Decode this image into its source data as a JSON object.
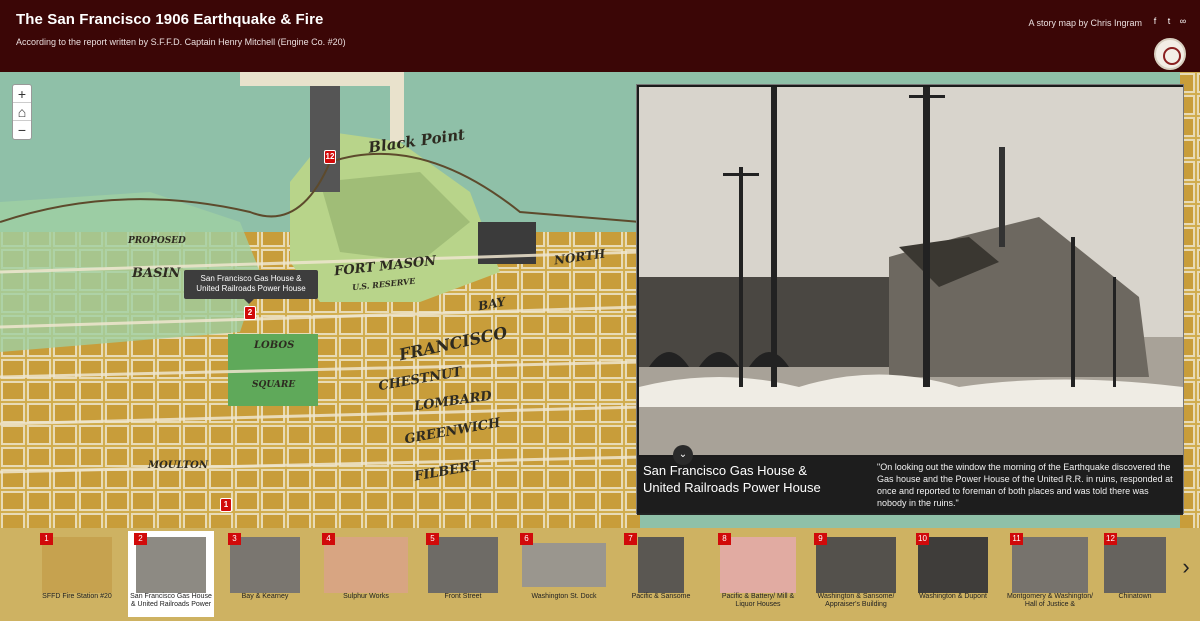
{
  "header": {
    "title": "The San Francisco 1906 Earthquake & Fire",
    "subtitle": "According to the report written by S.F.F.D. Captain Henry Mitchell (Engine Co. #20)",
    "author": "A story map by Chris Ingram",
    "share_icons": [
      "facebook-icon",
      "twitter-icon",
      "link-icon"
    ]
  },
  "map": {
    "zoom_in": "+",
    "home": "⌂",
    "zoom_out": "−",
    "labels": {
      "black_point": "Black Point",
      "fort_mason": "FORT MASON",
      "reserve": "U.S. RESERVE",
      "basin": "BASIN",
      "proposed": "PROPOSED",
      "lobos": "LOBOS",
      "square": "SQUARE",
      "francisco": "FRANCISCO",
      "chestnut": "CHESTNUT",
      "lombard": "LOMBARD",
      "greenwich": "GREENWICH",
      "filbert": "FILBERT",
      "north": "NORTH",
      "bay": "BAY",
      "moulton": "MOULTON"
    },
    "tooltip": "San Francisco Gas House & United Railroads Power House",
    "pins": [
      "2",
      "1",
      "12"
    ]
  },
  "panel": {
    "caption_title": "San Francisco Gas House & United Railroads Power House",
    "caption_text": "\"On looking out the window the morning of the Earthquake discovered the Gas house and the Power House of the United R.R. in ruins, responded at once and reported to foreman of both places and was told there was nobody in the ruins.\"",
    "collapse": "⌄"
  },
  "thumbnails": [
    {
      "num": "1",
      "label": "SFFD Fire Station #20"
    },
    {
      "num": "2",
      "label": "San Francisco Gas House & United Railroads Power"
    },
    {
      "num": "3",
      "label": "Bay & Kearney"
    },
    {
      "num": "4",
      "label": "Sulphur Works"
    },
    {
      "num": "5",
      "label": "Front Street"
    },
    {
      "num": "6",
      "label": "Washington St. Dock"
    },
    {
      "num": "7",
      "label": "Pacific & Sansome"
    },
    {
      "num": "8",
      "label": "Pacific & Battery/ Mill & Liquor Houses"
    },
    {
      "num": "9",
      "label": "Washington & Sansome/ Appraiser's Building"
    },
    {
      "num": "10",
      "label": "Washington & Dupont"
    },
    {
      "num": "11",
      "label": "Montgomery & Washington/ Hall of Justice &"
    },
    {
      "num": "12",
      "label": "Chinatown"
    }
  ],
  "next": "›"
}
